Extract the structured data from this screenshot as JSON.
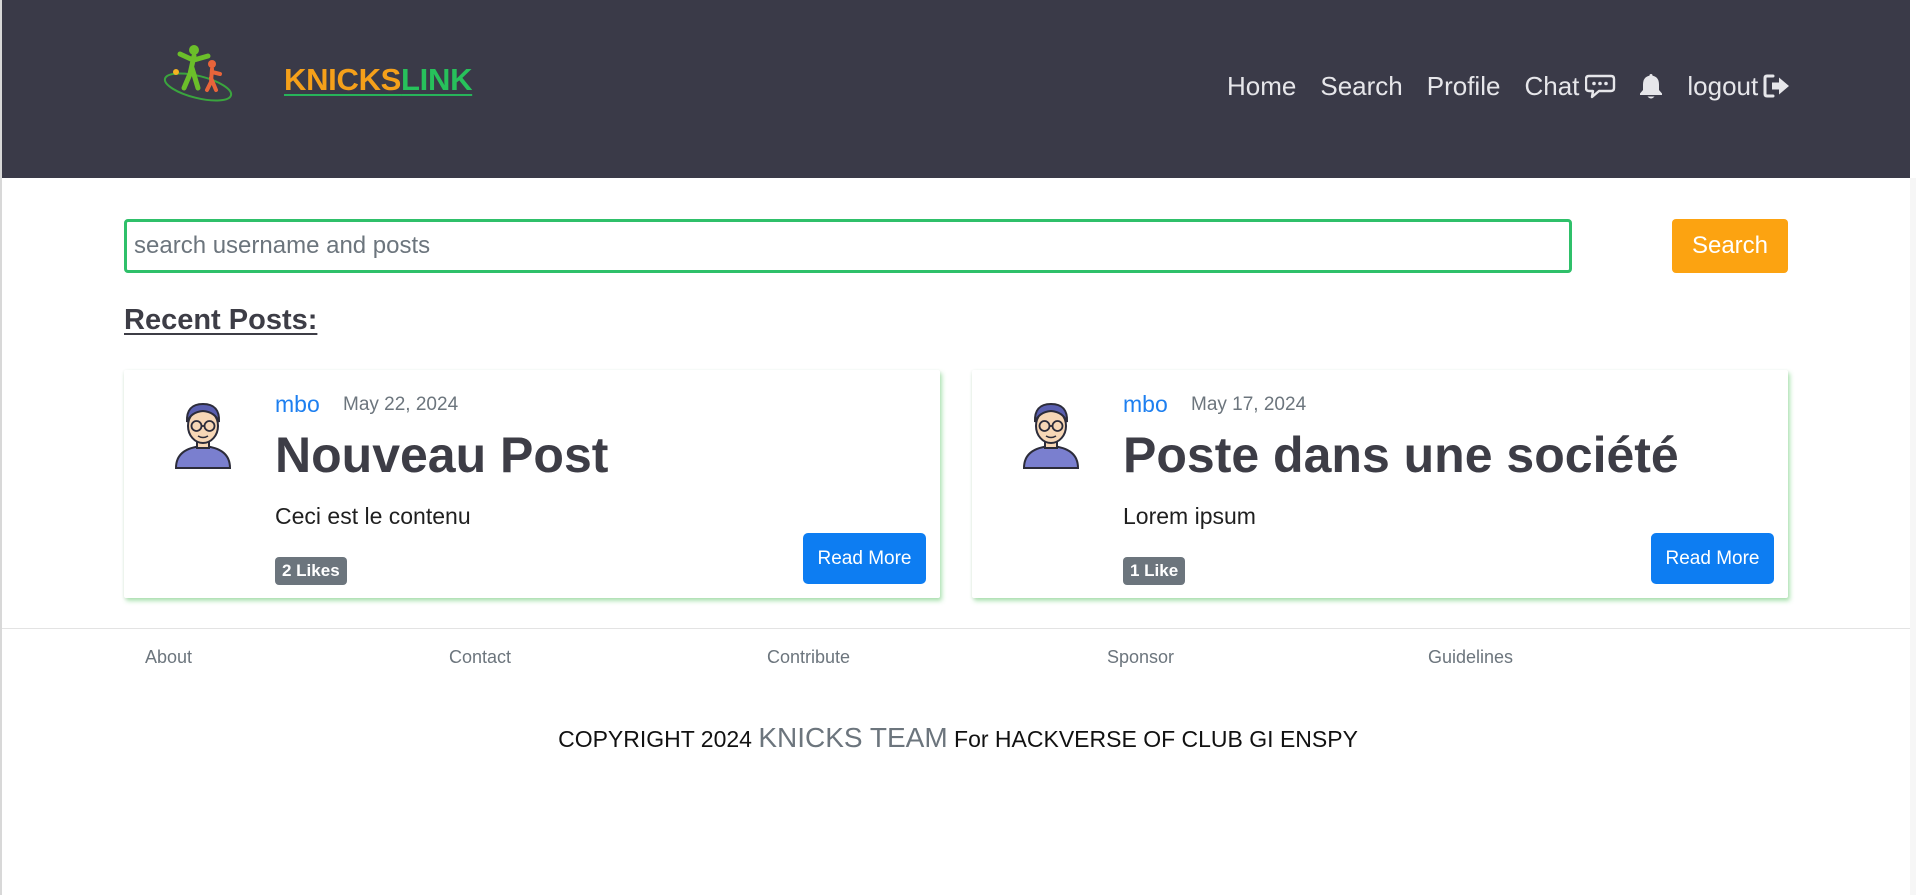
{
  "brand": {
    "part1": "KNICKS",
    "part2": "LINK"
  },
  "nav": {
    "home": "Home",
    "search": "Search",
    "profile": "Profile",
    "chat": "Chat",
    "logout": "logout"
  },
  "search": {
    "placeholder": "search username and posts",
    "button_label": "Search"
  },
  "section_title": "Recent Posts:",
  "posts": [
    {
      "author": "mbo",
      "date": "May 22, 2024",
      "title": "Nouveau Post",
      "body": "Ceci est le contenu",
      "likes": "2 Likes",
      "read_more": "Read More"
    },
    {
      "author": "mbo",
      "date": "May 17, 2024",
      "title": "Poste dans une société",
      "body": "Lorem ipsum",
      "likes": "1 Like",
      "read_more": "Read More"
    }
  ],
  "footer": {
    "links": [
      "About",
      "Contact",
      "Contribute",
      "Sponsor",
      "Guidelines"
    ],
    "copyright_prefix": "COPYRIGHT 2024 ",
    "copyright_team": "KNICKS TEAM",
    "copyright_suffix": " For HACKVERSE OF CLUB GI ENSPY"
  },
  "icons": {
    "chat": "chat-bubble-icon",
    "notifications": "bell-icon",
    "logout": "logout-icon",
    "avatar": "user-avatar"
  },
  "colors": {
    "header_bg": "#3a3a48",
    "brand_orange": "#f5a01a",
    "brand_green": "#27c15b",
    "search_border": "#2fc06a",
    "search_button": "#fca311",
    "link_blue": "#1d7ff0",
    "read_more_bg": "#0d7df2",
    "badge_bg": "#6c757d"
  }
}
